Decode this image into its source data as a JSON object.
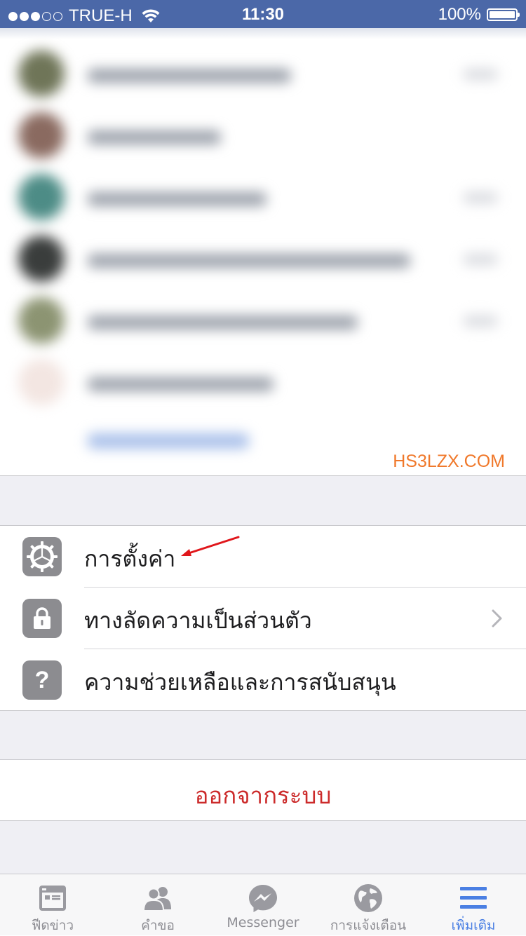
{
  "status_bar": {
    "carrier": "TRUE-H",
    "signal_bars_filled": 3,
    "signal_bars_total": 5,
    "time": "11:30",
    "battery_percent": "100%"
  },
  "watermark": "HS3LZX.COM",
  "menu": {
    "items": [
      {
        "label": "การตั้งค่า",
        "icon": "gear-icon"
      },
      {
        "label": "ทางลัดความเป็นส่วนตัว",
        "icon": "lock-icon",
        "has_chevron": true
      },
      {
        "label": "ความช่วยเหลือและการสนับสนุน",
        "icon": "question-icon"
      }
    ],
    "logout_label": "ออกจากระบบ"
  },
  "tab_bar": {
    "tabs": [
      {
        "label": "ฟีดข่าว",
        "icon": "news-feed-icon"
      },
      {
        "label": "คำขอ",
        "icon": "friends-icon"
      },
      {
        "label": "Messenger",
        "icon": "messenger-icon"
      },
      {
        "label": "การแจ้งเตือน",
        "icon": "globe-icon"
      },
      {
        "label": "เพิ่มเติม",
        "icon": "menu-icon",
        "active": true
      }
    ]
  },
  "colors": {
    "status_bar_bg": "#4b68a8",
    "logout_text": "#cc2b2b",
    "active_tab": "#4a7fe3",
    "watermark": "#f0782a"
  }
}
